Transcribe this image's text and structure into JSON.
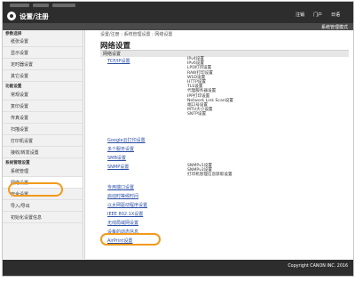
{
  "header": {
    "app_title": "设置/注册",
    "links": [
      "注销",
      "门户",
      "日语"
    ],
    "mode_label": "系统管理模式"
  },
  "sidebar": {
    "groups": [
      {
        "title": "参数选择",
        "items": [
          "纸张设置",
          "显示设置",
          "定时器设置",
          "其它设置"
        ]
      },
      {
        "title": "功能设置",
        "items": [
          "常规设置",
          "复印设置",
          "传真设置",
          "扫描设置",
          "打印机设置",
          "接收/转发设置"
        ]
      },
      {
        "title": "系统管理设置",
        "items": [
          "系统管理",
          "网络设置",
          "安全设置",
          "导入/导出",
          "初始化设置信息"
        ]
      }
    ],
    "active_item": "网络设置"
  },
  "main": {
    "breadcrumb": "设置/注册 : 系统管理设置 : 网络设置",
    "page_title": "网络设置",
    "section_title": "网络设置",
    "tcpip_link": "TCP/IP设置",
    "tcpip_sub": [
      "IPv4设置",
      "IPv6设置",
      "LPD打印设置",
      "RAW打印设置",
      "WSD设置",
      "HTTP设置",
      "TLS设置",
      "代理服务器设置",
      "IPP打印设置",
      "Network Link Scan设置",
      "端口号设置",
      "MTU大小设置",
      "SNTP设置"
    ],
    "google_link": "Google云打印设置",
    "multi_link": "多个服务设置",
    "smb_link": "SMB设置",
    "snmp_link": "SNMP设置",
    "snmp_sub": [
      "SNMPv1设置",
      "SNMPv3设置",
      "打印机管理信息获取设置"
    ],
    "links": [
      "专用端口设置",
      "启动时等候时间",
      "以太网驱动程序设置",
      "IEEE 802.1X设置",
      "无线局域网设置",
      "设备的动态信息"
    ],
    "airprint_link": "AirPrint设置"
  },
  "footer": {
    "copyright": "Copyright CANON INC. 2016"
  },
  "colors": {
    "highlight": "#f39a1b",
    "header_bg": "#2d2d2d",
    "link": "#2a4ea5"
  }
}
